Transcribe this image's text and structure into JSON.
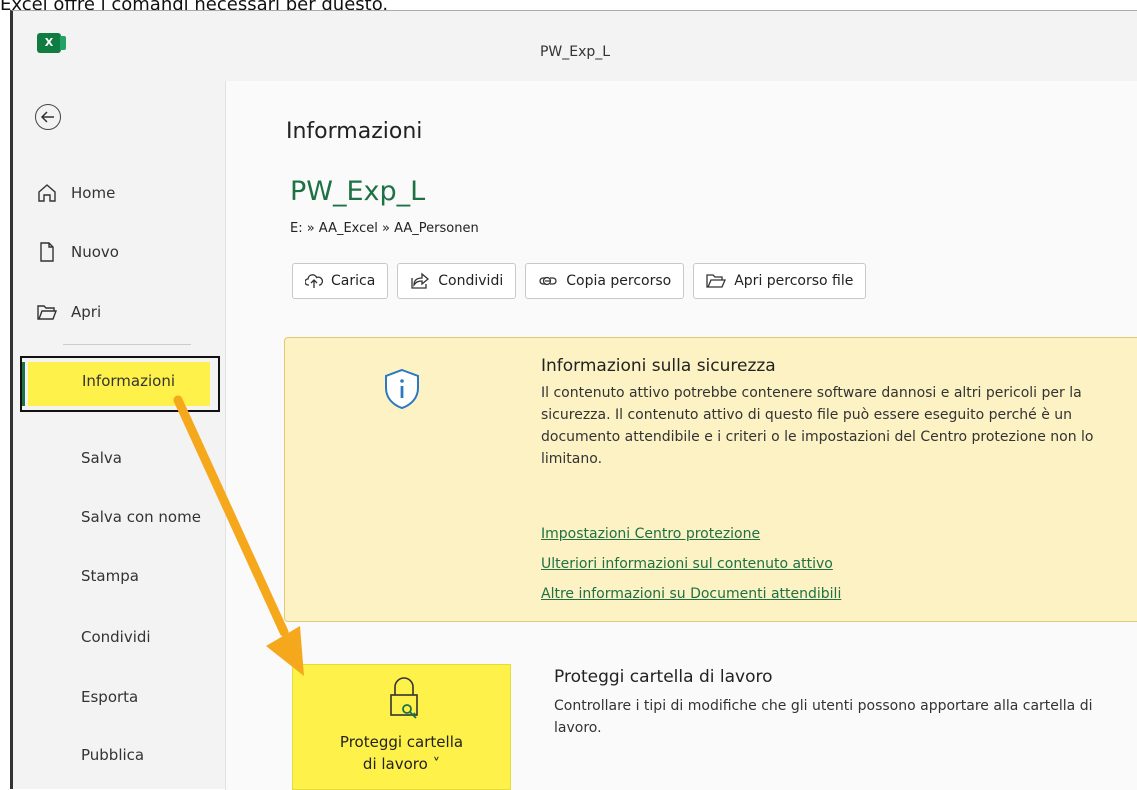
{
  "caption": "Excel offre i comandi necessari per questo.",
  "window": {
    "title": "PW_Exp_L",
    "app_logo": "X"
  },
  "sidebar": {
    "back_icon": "back-arrow-icon",
    "items": [
      {
        "label": "Home",
        "icon": "home-icon"
      },
      {
        "label": "Nuovo",
        "icon": "new-document-icon"
      },
      {
        "label": "Apri",
        "icon": "folder-open-icon"
      },
      {
        "label": "Informazioni",
        "active": true
      },
      {
        "label": "Salva"
      },
      {
        "label": "Salva con nome"
      },
      {
        "label": "Stampa"
      },
      {
        "label": "Condividi"
      },
      {
        "label": "Esporta"
      },
      {
        "label": "Pubblica"
      }
    ],
    "highlight_color": "#fdf14a"
  },
  "main": {
    "heading": "Informazioni",
    "file_name": "PW_Exp_L",
    "file_path": "E: » AA_Excel » AA_Personen",
    "buttons": [
      {
        "label": "Carica",
        "icon": "cloud-upload-icon"
      },
      {
        "label": "Condividi",
        "icon": "share-icon"
      },
      {
        "label": "Copia percorso",
        "icon": "link-icon"
      },
      {
        "label": "Apri percorso file",
        "icon": "folder-open-icon"
      }
    ],
    "security": {
      "title": "Informazioni sulla sicurezza",
      "body": "Il contenuto attivo potrebbe contenere software dannosi e altri pericoli per la sicurezza. Il contenuto attivo di questo file può essere eseguito perché è un documento attendibile e i criteri o le impostazioni del Centro protezione non lo limitano.",
      "links": [
        "Impostazioni Centro protezione",
        "Ulteriori informazioni sul contenuto attivo",
        "Altre informazioni su Documenti attendibili"
      ],
      "background": "#fcf2c4"
    },
    "protect": {
      "tile_label_line1": "Proteggi cartella",
      "tile_label_line2": "di lavoro ˅",
      "title": "Proteggi cartella di lavoro",
      "description": "Controllare i tipi di modifiche che gli utenti possono apportare alla cartella di lavoro."
    }
  },
  "annotation": {
    "arrow_color": "#f5a81c"
  },
  "accent_color": "#1e7145"
}
